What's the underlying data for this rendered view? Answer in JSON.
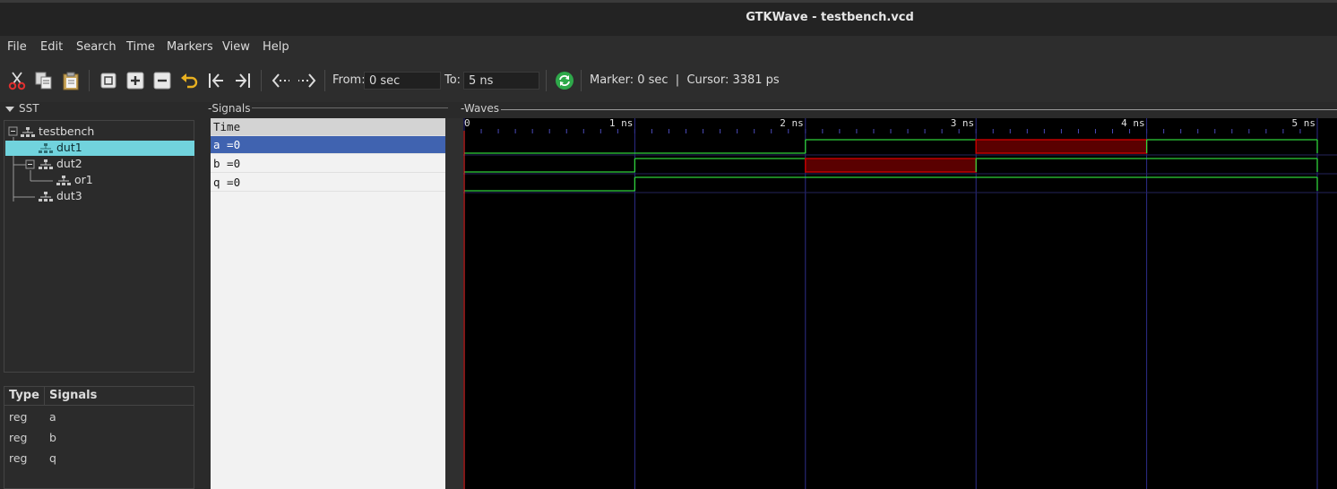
{
  "window": {
    "title": "GTKWave - testbench.vcd"
  },
  "menu": [
    "File",
    "Edit",
    "Search",
    "Time",
    "Markers",
    "View",
    "Help"
  ],
  "toolbar": {
    "icons": [
      "cut-icon",
      "copy-icon",
      "paste-icon",
      "zoom-fit-icon",
      "zoom-in-icon",
      "zoom-out-icon",
      "undo-zoom-icon",
      "zoom-to-start-icon",
      "zoom-to-end-icon",
      "find-previous-edge-icon",
      "find-next-edge-icon",
      "reload-icon"
    ],
    "from_label": "From:",
    "from_value": "0 sec",
    "to_label": "To:",
    "to_value": "5 ns",
    "marker_text": "Marker: 0 sec  |  Cursor: 3381 ps"
  },
  "sst": {
    "header": "SST",
    "tree": [
      {
        "label": "testbench",
        "level": 0,
        "expander": "minus",
        "selected": false
      },
      {
        "label": "dut1",
        "level": 1,
        "expander": "",
        "selected": true
      },
      {
        "label": "dut2",
        "level": 1,
        "expander": "minus",
        "selected": false
      },
      {
        "label": "or1",
        "level": 2,
        "expander": "",
        "selected": false
      },
      {
        "label": "dut3",
        "level": 1,
        "expander": "",
        "selected": false
      }
    ]
  },
  "type_table": {
    "headers": [
      "Type",
      "Signals"
    ],
    "rows": [
      {
        "type": "reg",
        "signal": "a"
      },
      {
        "type": "reg",
        "signal": "b"
      },
      {
        "type": "reg",
        "signal": "q"
      }
    ]
  },
  "signals_panel": {
    "header": "Signals",
    "time_label": "Time",
    "rows": [
      {
        "label": "a =0",
        "selected": true
      },
      {
        "label": "b =0",
        "selected": false
      },
      {
        "label": "q =0",
        "selected": false
      }
    ]
  },
  "waves_panel": {
    "header": "Waves",
    "tick_labels": [
      "0",
      "1 ns",
      "2 ns",
      "3 ns",
      "4 ns",
      "5 ns"
    ],
    "time_range_ns": [
      0,
      5
    ],
    "cursor_ns": 3.381,
    "colors": {
      "trace": "#2fd13a",
      "undefined": "#c00000",
      "grid": "#2d2d8a",
      "marker": "#ff3030",
      "background": "#000000"
    },
    "signals": [
      {
        "name": "a",
        "segments": [
          {
            "from": 0,
            "to": 2,
            "level": 0
          },
          {
            "from": 2,
            "to": 3,
            "level": 1
          },
          {
            "from": 3,
            "to": 4,
            "level": "x"
          },
          {
            "from": 4,
            "to": 5,
            "level": 1
          }
        ]
      },
      {
        "name": "b",
        "segments": [
          {
            "from": 0,
            "to": 1,
            "level": 0
          },
          {
            "from": 1,
            "to": 2,
            "level": 1
          },
          {
            "from": 2,
            "to": 3,
            "level": "x"
          },
          {
            "from": 3,
            "to": 5,
            "level": 1
          }
        ]
      },
      {
        "name": "q",
        "segments": [
          {
            "from": 0,
            "to": 1,
            "level": 0
          },
          {
            "from": 1,
            "to": 5,
            "level": 1
          }
        ]
      }
    ]
  }
}
